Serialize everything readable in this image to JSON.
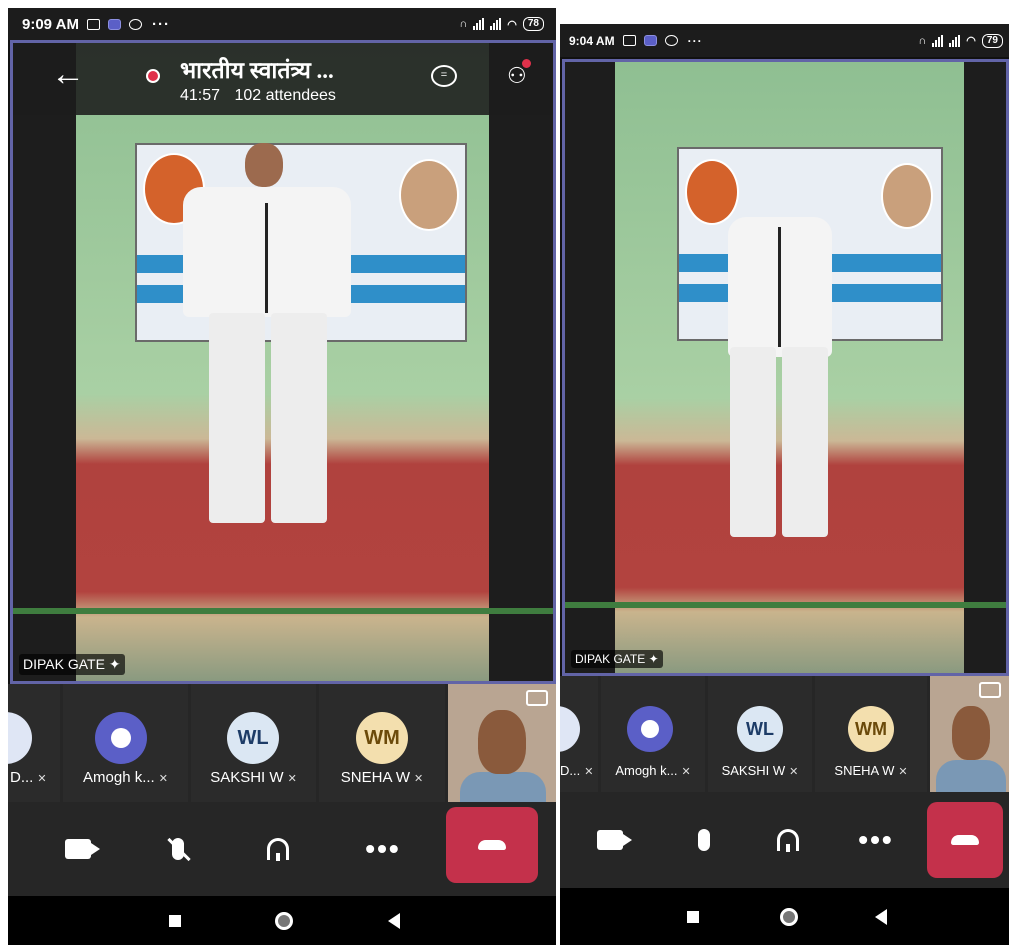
{
  "left_screen": {
    "status_bar": {
      "time": "9:09 AM",
      "battery": "78"
    },
    "meeting": {
      "title": "भारतीय स्वातंत्र्य ...",
      "duration": "41:57",
      "attendees": "102 attendees"
    },
    "pinned_name": "DIPAK GATE",
    "participants": [
      {
        "label": "D..."
      },
      {
        "label": "Amogh k..."
      },
      {
        "label": "SAKSHI W",
        "initials": "WL"
      },
      {
        "label": "SNEHA W",
        "initials": "WM"
      }
    ]
  },
  "right_screen": {
    "status_bar": {
      "time": "9:04 AM",
      "battery": "79"
    },
    "pinned_name": "DIPAK GATE",
    "participants": [
      {
        "label": "D..."
      },
      {
        "label": "Amogh k..."
      },
      {
        "label": "SAKSHI W",
        "initials": "WL"
      },
      {
        "label": "SNEHA W",
        "initials": "WM"
      }
    ]
  },
  "icons": {
    "back": "←",
    "more": "•••",
    "status_dots": "···"
  },
  "colors": {
    "accent": "#6264a7",
    "hangup": "#c4314b",
    "recording": "#e0314b",
    "avatar_purple": "#5b5fc7"
  }
}
